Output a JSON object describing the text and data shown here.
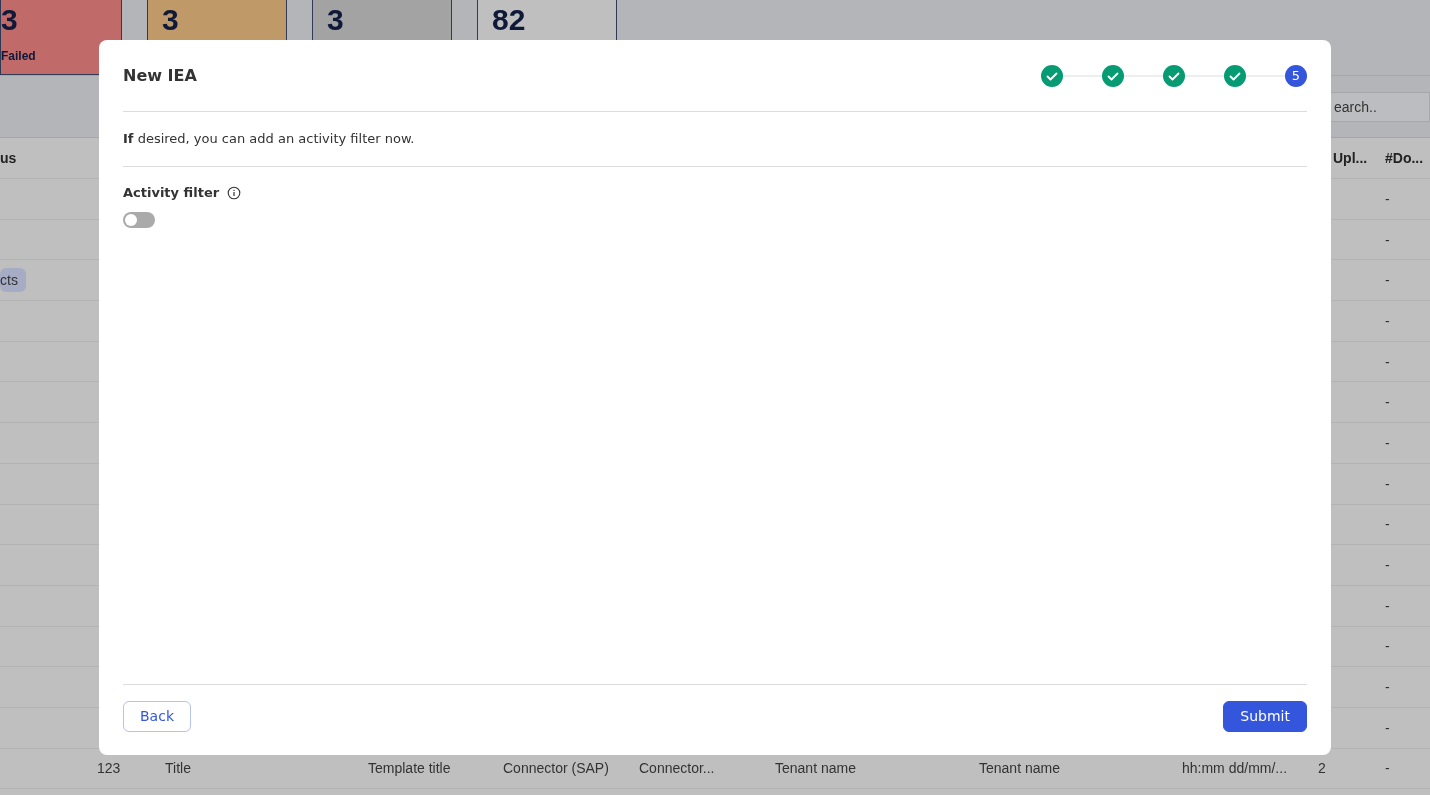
{
  "stat_cards": [
    {
      "value": "3",
      "label": "Failed",
      "color": "#c06a6a"
    },
    {
      "value": "3",
      "color": "#bf9a68"
    },
    {
      "value": "3",
      "color": "#a3a3a3"
    },
    {
      "value": "82",
      "color": "#bfbfbf"
    }
  ],
  "search": {
    "placeholder": "earch.."
  },
  "table": {
    "columns": [
      "us",
      null,
      null,
      null,
      null,
      null,
      null,
      null,
      null,
      "Upl...",
      "#Do..."
    ],
    "rows": [
      {
        "cells": [
          null,
          null,
          null,
          null,
          null,
          null,
          null,
          null,
          null,
          null,
          "-"
        ]
      },
      {
        "cells": [
          null,
          null,
          null,
          null,
          null,
          null,
          null,
          null,
          null,
          null,
          "-"
        ]
      },
      {
        "cells": [
          "cts",
          null,
          null,
          null,
          null,
          null,
          null,
          null,
          null,
          null,
          "-"
        ]
      },
      {
        "cells": [
          null,
          null,
          null,
          null,
          null,
          null,
          null,
          null,
          null,
          null,
          "-"
        ]
      },
      {
        "cells": [
          null,
          null,
          null,
          null,
          null,
          null,
          null,
          null,
          null,
          null,
          "-"
        ]
      },
      {
        "cells": [
          null,
          null,
          null,
          null,
          null,
          null,
          null,
          null,
          null,
          null,
          "-"
        ]
      },
      {
        "cells": [
          null,
          null,
          null,
          null,
          null,
          null,
          null,
          null,
          null,
          null,
          "-"
        ]
      },
      {
        "cells": [
          null,
          null,
          null,
          null,
          null,
          null,
          null,
          null,
          null,
          null,
          "-"
        ]
      },
      {
        "cells": [
          null,
          null,
          null,
          null,
          null,
          null,
          null,
          null,
          null,
          null,
          "-"
        ]
      },
      {
        "cells": [
          null,
          null,
          null,
          null,
          null,
          null,
          null,
          null,
          null,
          null,
          "-"
        ]
      },
      {
        "cells": [
          null,
          null,
          null,
          null,
          null,
          null,
          null,
          null,
          null,
          null,
          "-"
        ]
      },
      {
        "cells": [
          null,
          null,
          null,
          null,
          null,
          null,
          null,
          null,
          null,
          null,
          "-"
        ]
      },
      {
        "cells": [
          null,
          null,
          null,
          null,
          null,
          null,
          null,
          null,
          null,
          null,
          "-"
        ]
      },
      {
        "cells": [
          null,
          null,
          null,
          null,
          null,
          null,
          null,
          null,
          null,
          null,
          "-"
        ]
      },
      {
        "cells": [
          null,
          "123",
          "Title",
          "Template title",
          "Connector (SAP)",
          "Connector...",
          "Tenant name",
          "Tenant name",
          "hh:mm dd/mm/...",
          "2",
          "-"
        ]
      }
    ]
  },
  "dialog": {
    "title": "New IEA",
    "steps": [
      {
        "completed": true
      },
      {
        "completed": true
      },
      {
        "completed": true
      },
      {
        "completed": true
      },
      {
        "completed": false,
        "label": "5"
      }
    ],
    "intro": "**If** desired, you can add an activity filter now.",
    "field_label": "Activity filter",
    "toggle": {
      "on": false
    },
    "buttons": [
      {
        "kind": "secondary",
        "label": "Back"
      },
      {
        "kind": "primary",
        "label": "Submit"
      }
    ]
  }
}
